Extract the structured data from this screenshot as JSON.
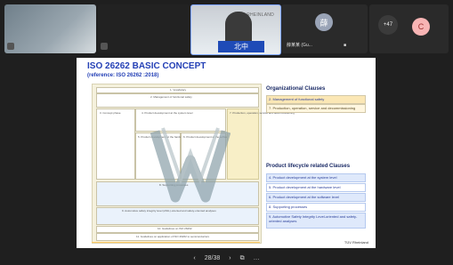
{
  "participants": {
    "tile1": {
      "name": ""
    },
    "tile2": {
      "name": ""
    },
    "presenter": {
      "sign_text": "北中",
      "badge": "TUV RHEINLAND"
    },
    "tile4": {
      "avatar_initial": "薛",
      "avatar_color": "#9aa4b7",
      "name": "薛某某 (Gu...",
      "mic": "■"
    },
    "tile5": {
      "more": "+47",
      "avatar_initial": "C",
      "avatar_color": "#f7b4b4"
    }
  },
  "slide": {
    "title": "ISO 26262  BASIC CONCEPT",
    "subtitle": "(reference: ISO 26262 :2018)",
    "org": {
      "heading": "Organizational Clauses",
      "items": [
        "2. Management of functional safety",
        "7. Production, operation, service and decommissioning"
      ]
    },
    "lifecycle": {
      "heading": "Product lifecycle related Clauses",
      "items": [
        "4. Product development at the system level",
        "5. Product development at the hardware level",
        "6. Product development at the software level",
        "8. Supporting processes",
        "9. Automotive Safety Integrity Level-oriented and safety-oriented analyses"
      ]
    },
    "diagram": {
      "top": "1. Vocabulary",
      "mgmt": "2. Management of functional safety",
      "concept": "3. Concept phase",
      "system": "4. Product development at the system level",
      "hw": "5. Product development at the hardware level",
      "sw": "6. Product development at the software level",
      "prod": "7. Production, operation, service and decommissioning",
      "support": "8. Supporting processes",
      "asil": "9. Automotive safety integrity level (ASIL)-oriented and safety-oriented analyses",
      "guidelines": "10. Guidelines on ISO 26262",
      "semi": "11. Guidelines on application of ISO 26262 to semiconductors"
    },
    "footer_logo": "TÜV Rheinland"
  },
  "toolbar": {
    "prev": "‹",
    "page": "28/38",
    "next": "›",
    "copy_icon": "⧉",
    "more": "…"
  }
}
